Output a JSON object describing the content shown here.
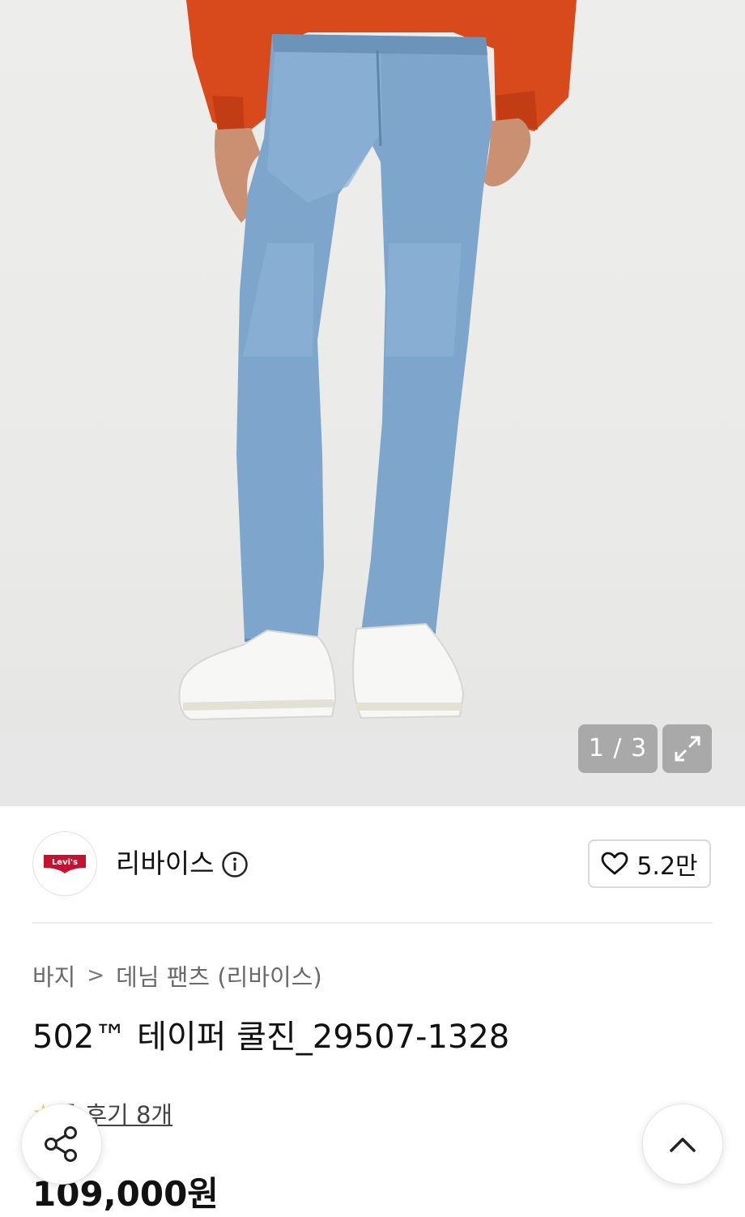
{
  "gallery": {
    "counter": "1 / 3",
    "expand_icon": "expand-icon"
  },
  "brand": {
    "logo_text": "Levi's",
    "name": "리바이스",
    "info_icon": "info-icon",
    "like_count": "5.2만",
    "heart_icon": "heart-icon",
    "brand_color": "#c41230"
  },
  "breadcrumb": {
    "category": "바지",
    "separator": ">",
    "subcategory": "데님 팬츠 (리바이스)"
  },
  "product": {
    "title": "502™ 테이퍼 쿨진_29507-1328",
    "rating": "5",
    "reviews": "후기 8개",
    "price": "109,000원"
  },
  "fab": {
    "share_icon": "share-icon",
    "scroll_top_icon": "chevron-up-icon"
  }
}
